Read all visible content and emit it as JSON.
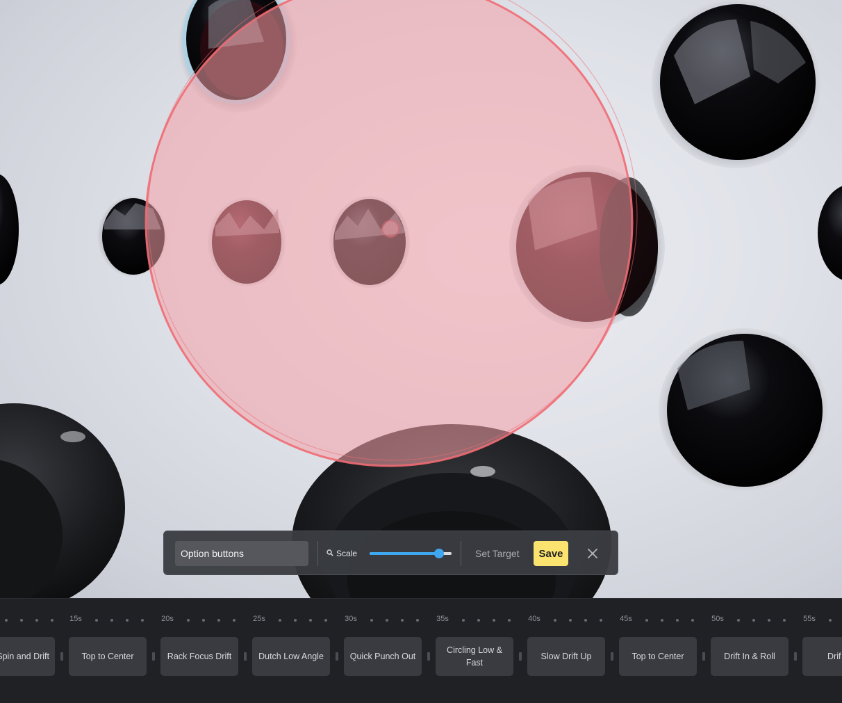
{
  "toolbar": {
    "name_value": "Option buttons",
    "scale_icon": "magnifier-icon",
    "scale_label": "Scale",
    "scale_value": 0.85,
    "set_target_label": "Set Target",
    "save_label": "Save",
    "close_icon": "close-icon"
  },
  "timeline": {
    "ticks": [
      "15s",
      "20s",
      "25s",
      "30s",
      "35s",
      "40s",
      "45s",
      "50s",
      "55s"
    ],
    "clips": [
      "w Spin and Drift",
      "Top to Center",
      "Rack Focus Drift",
      "Dutch Low Angle",
      "Quick Punch Out",
      "Circling Low & Fast",
      "Slow Drift Up",
      "Top to Center",
      "Drift In & Roll",
      "Drif"
    ]
  },
  "colors": {
    "accent": "#3ea7f0",
    "save": "#fbe36f",
    "target": "#f06b73"
  }
}
